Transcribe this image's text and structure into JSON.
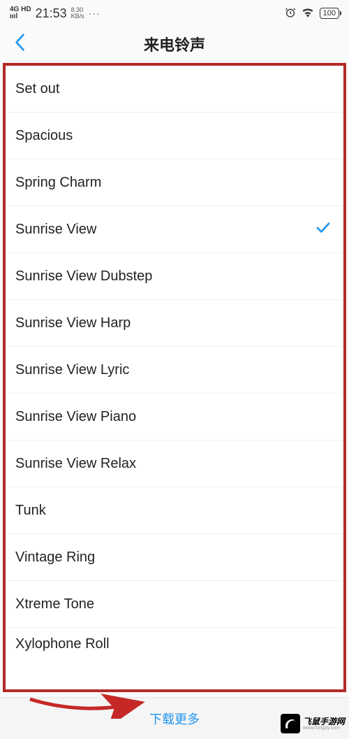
{
  "status": {
    "network_type": "4G HD",
    "time": "21:53",
    "speed_value": "8.30",
    "speed_unit": "KB/s",
    "dots": "···",
    "battery": "100"
  },
  "header": {
    "title": "来电铃声"
  },
  "ringtones": [
    {
      "name": "Set out",
      "selected": false
    },
    {
      "name": "Spacious",
      "selected": false
    },
    {
      "name": "Spring Charm",
      "selected": false
    },
    {
      "name": "Sunrise View",
      "selected": true
    },
    {
      "name": "Sunrise View Dubstep",
      "selected": false
    },
    {
      "name": "Sunrise View Harp",
      "selected": false
    },
    {
      "name": "Sunrise View Lyric",
      "selected": false
    },
    {
      "name": "Sunrise View Piano",
      "selected": false
    },
    {
      "name": "Sunrise View Relax",
      "selected": false
    },
    {
      "name": "Tunk",
      "selected": false
    },
    {
      "name": "Vintage Ring",
      "selected": false
    },
    {
      "name": "Xtreme Tone",
      "selected": false
    },
    {
      "name": "Xylophone Roll",
      "selected": false
    }
  ],
  "footer": {
    "download_more": "下载更多"
  },
  "watermark": {
    "cn": "飞鼠手游网",
    "url": "www.fsxtgsy.com"
  }
}
